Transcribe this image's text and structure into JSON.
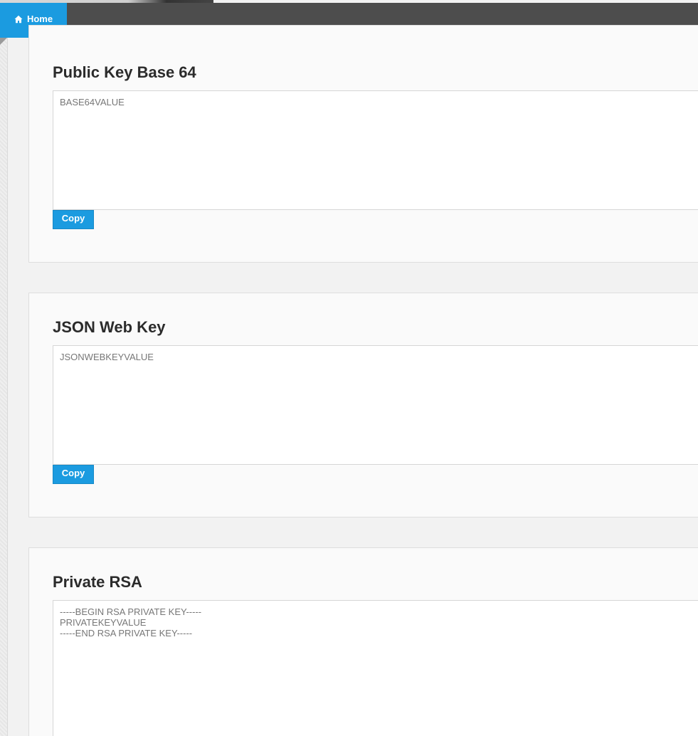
{
  "nav": {
    "home_label": "Home",
    "home_icon": "home-icon"
  },
  "panels": [
    {
      "title": "Public Key Base 64",
      "textarea_value": "BASE64VALUE",
      "copy_label": "Copy"
    },
    {
      "title": "JSON Web Key",
      "textarea_value": "JSONWEBKEYVALUE",
      "copy_label": "Copy"
    },
    {
      "title": "Private RSA",
      "textarea_value": "-----BEGIN RSA PRIVATE KEY-----\nPRIVATEKEYVALUE\n-----END RSA PRIVATE KEY-----"
    }
  ],
  "colors": {
    "accent": "#1b9be0",
    "navbar": "#4d4d4d"
  }
}
